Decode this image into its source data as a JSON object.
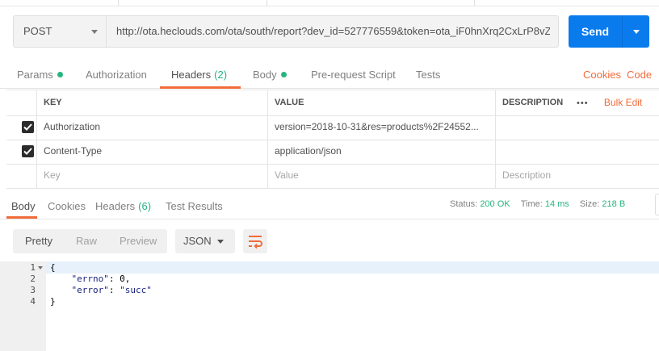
{
  "request": {
    "method": "POST",
    "url": "http://ota.heclouds.com/ota/south/report?dev_id=527776559&token=ota_iF0hnXrq2CxLrP8vZ...",
    "send_label": "Send"
  },
  "request_tabs": [
    {
      "label": "Params",
      "has_dot": true
    },
    {
      "label": "Authorization"
    },
    {
      "label": "Headers",
      "count": "(2)",
      "active": true
    },
    {
      "label": "Body",
      "has_dot": true
    },
    {
      "label": "Pre-request Script"
    },
    {
      "label": "Tests"
    }
  ],
  "request_links": {
    "cookies": "Cookies",
    "code": "Code"
  },
  "headers_table": {
    "columns": {
      "key": "KEY",
      "value": "VALUE",
      "description": "DESCRIPTION"
    },
    "more_label": "•••",
    "bulk_edit_label": "Bulk Edit",
    "rows": [
      {
        "checked": true,
        "key": "Authorization",
        "value": "version=2018-10-31&res=products%2F24552...",
        "description": ""
      },
      {
        "checked": true,
        "key": "Content-Type",
        "value": "application/json",
        "description": ""
      }
    ],
    "placeholders": {
      "key": "Key",
      "value": "Value",
      "description": "Description"
    }
  },
  "response_tabs": [
    {
      "label": "Body",
      "active": true
    },
    {
      "label": "Cookies"
    },
    {
      "label": "Headers",
      "count": "(6)"
    },
    {
      "label": "Test Results"
    }
  ],
  "response_status": {
    "status_label": "Status:",
    "status_value": "200 OK",
    "time_label": "Time:",
    "time_value": "14 ms",
    "size_label": "Size:",
    "size_value": "218 B"
  },
  "response_toolbar": {
    "formats": [
      "Pretty",
      "Raw",
      "Preview"
    ],
    "active_format": "Pretty",
    "language": "JSON",
    "wrap_icon": "wrap-lines-icon"
  },
  "response_body": {
    "line_numbers": [
      "1",
      "2",
      "3",
      "4"
    ],
    "open_brace": "{",
    "close_brace": "}",
    "fields": [
      {
        "key": "\"errno\"",
        "sep": ": ",
        "value": "0",
        "trail": ","
      },
      {
        "key": "\"error\"",
        "sep": ": ",
        "value": "\"succ\"",
        "trail": ""
      }
    ]
  },
  "colors": {
    "accent_orange": "#f26b3a",
    "send_blue": "#097bed",
    "status_green": "#26b47f"
  }
}
